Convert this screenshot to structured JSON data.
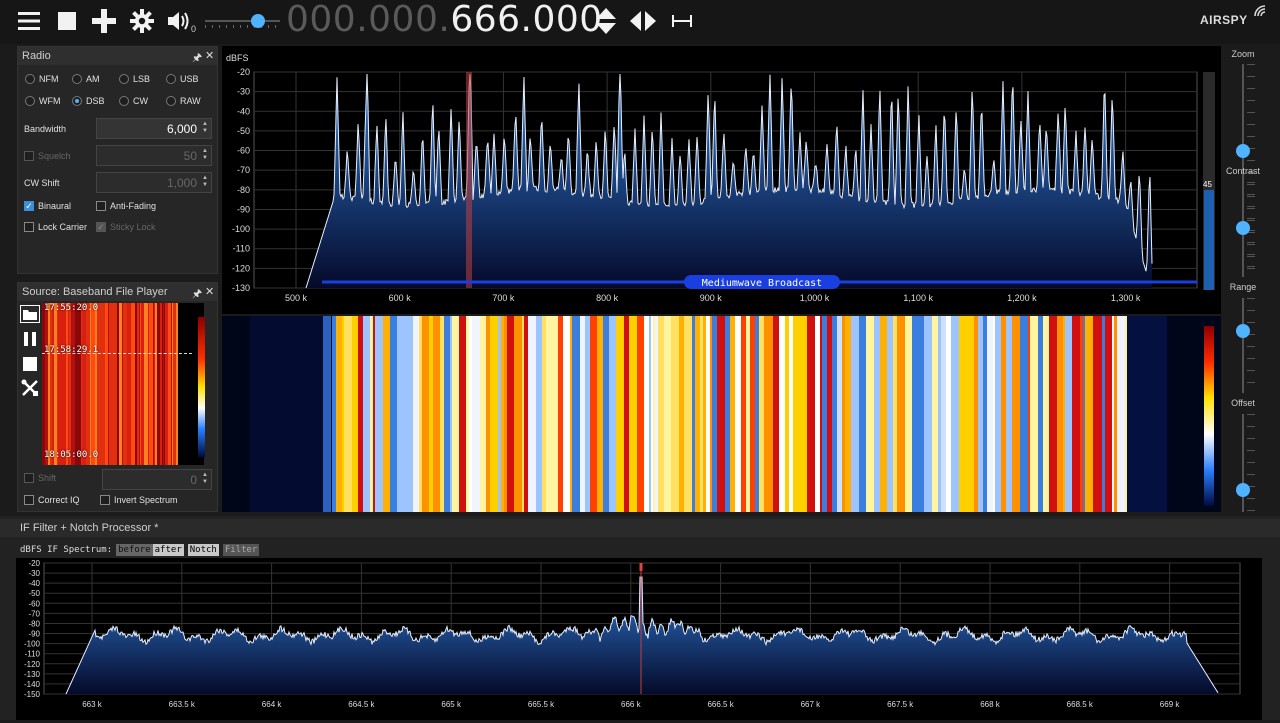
{
  "toolbar": {
    "icons": [
      "menu-icon",
      "stop-icon",
      "add-icon",
      "gear-icon",
      "speaker-icon"
    ],
    "volume_fraction": 0.7,
    "volume_sub": "0",
    "frequency_dim": "000.000.",
    "frequency_lit": "666.000",
    "logo": "AIRSPY"
  },
  "radio_panel": {
    "title": "Radio",
    "modes": [
      {
        "label": "NFM",
        "selected": false
      },
      {
        "label": "AM",
        "selected": false
      },
      {
        "label": "LSB",
        "selected": false
      },
      {
        "label": "USB",
        "selected": false
      },
      {
        "label": "WFM",
        "selected": false
      },
      {
        "label": "DSB",
        "selected": true
      },
      {
        "label": "CW",
        "selected": false
      },
      {
        "label": "RAW",
        "selected": false
      }
    ],
    "bandwidth_label": "Bandwidth",
    "bandwidth_value": "6,000",
    "squelch_label": "Squelch",
    "squelch_value": "50",
    "cw_shift_label": "CW Shift",
    "cw_shift_value": "1,000",
    "binaural_label": "Binaural",
    "anti_fading_label": "Anti-Fading",
    "lock_carrier_label": "Lock Carrier",
    "sticky_lock_label": "Sticky Lock"
  },
  "source_panel": {
    "title": "Source: Baseband File Player",
    "times": [
      "17:55:20.0",
      "17:58:29.1",
      "18:05:00.0"
    ],
    "shift_label": "Shift",
    "shift_value": "0",
    "correct_iq_label": "Correct IQ",
    "invert_spectrum_label": "Invert Spectrum"
  },
  "main_spectrum": {
    "unit": "dBFS",
    "y_ticks": [
      "-20",
      "-30",
      "-40",
      "-50",
      "-60",
      "-70",
      "-80",
      "-90",
      "-100",
      "-110",
      "-120",
      "-130"
    ],
    "x_ticks": [
      "500 k",
      "600 k",
      "700 k",
      "800 k",
      "900 k",
      "1,000 k",
      "1,100 k",
      "1,200 k",
      "1,300 k"
    ],
    "band_label": "Mediumwave Broadcast",
    "side_value": "45"
  },
  "sliders": {
    "zoom_label": "Zoom",
    "contrast_label": "Contrast",
    "range_label": "Range",
    "offset_label": "Offset"
  },
  "if_panel": {
    "title": "IF Filter + Notch Processor *",
    "spectrum_caption": "dBFS IF Spectrum:",
    "btn_before": "before",
    "btn_after": "after",
    "btn_notch": "Notch",
    "btn_filter": "Filter",
    "y_ticks": [
      "-20",
      "-30",
      "-40",
      "-50",
      "-60",
      "-70",
      "-80",
      "-90",
      "-100",
      "-110",
      "-120",
      "-130",
      "-140",
      "-150"
    ],
    "x_ticks": [
      "663 k",
      "663.5 k",
      "664 k",
      "664.5 k",
      "665 k",
      "665.5 k",
      "666 k",
      "666.5 k",
      "667 k",
      "667.5 k",
      "668 k",
      "668.5 k",
      "669 k"
    ]
  },
  "colors": {
    "accent": "#4fb3ff",
    "spectrum_fill": "#1f5fb0",
    "marker": "#c04040"
  }
}
